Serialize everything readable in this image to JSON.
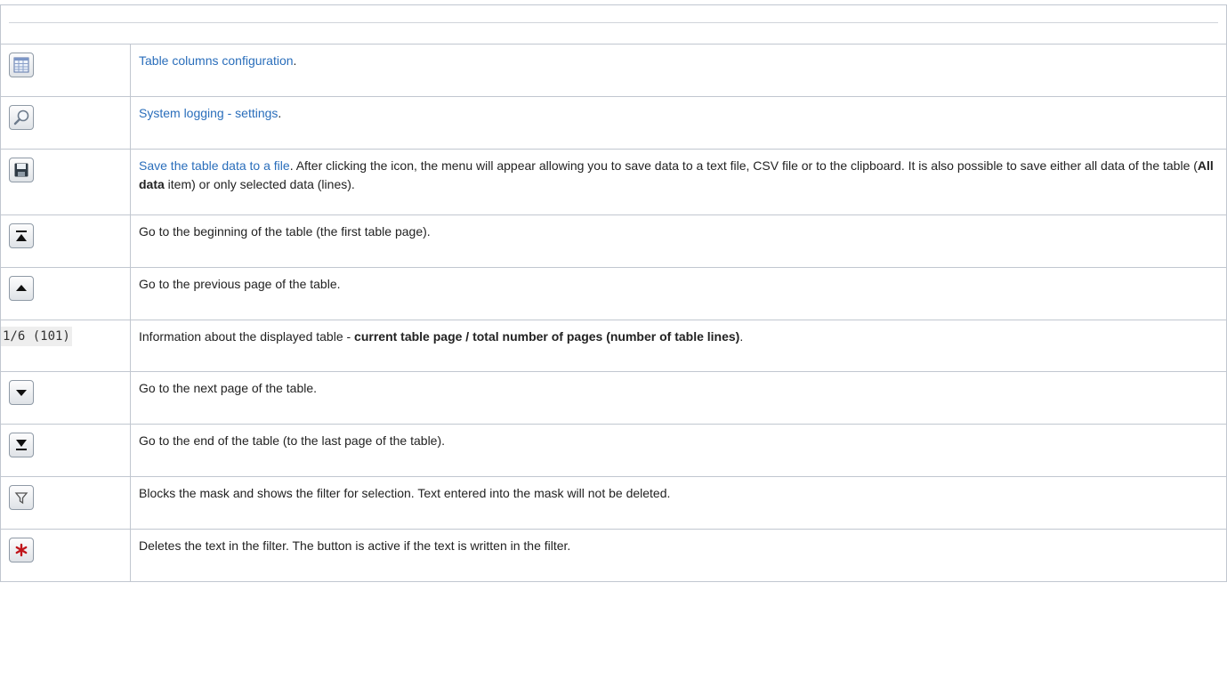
{
  "rows": [
    {
      "icon": "table-columns-icon",
      "link": "Table columns configuration",
      "after_link": "."
    },
    {
      "icon": "magnifier-icon",
      "link": "System logging - settings",
      "after_link": "."
    },
    {
      "icon": "save-disk-icon",
      "link": "Save the table data to a file",
      "after_link": ". After clicking the icon, the menu will appear allowing you to save data to a text file, CSV file or to the clipboard. It is also possible to save either all data of the table (",
      "bold": "All data",
      "tail": " item) or only selected data (lines)."
    },
    {
      "icon": "go-first-page-icon",
      "text": "Go to the beginning of the table (the first table page)."
    },
    {
      "icon": "go-previous-page-icon",
      "text": "Go to the previous page of the table."
    },
    {
      "icon_text": "1/6 (101)",
      "text": "Information about the displayed table - ",
      "bold": "current table page / total number of pages (number of table lines)",
      "tail": "."
    },
    {
      "icon": "go-next-page-icon",
      "text": "Go to the next page of the table."
    },
    {
      "icon": "go-last-page-icon",
      "text": "Go to the end of the table (to the last page of the table)."
    },
    {
      "icon": "filter-funnel-icon",
      "text": "Blocks the mask and shows the filter for selection. Text entered into the mask will not be deleted."
    },
    {
      "icon": "clear-filter-asterisk-icon",
      "text": "Deletes the text in the filter. The button is active if the text is written in the filter."
    }
  ]
}
